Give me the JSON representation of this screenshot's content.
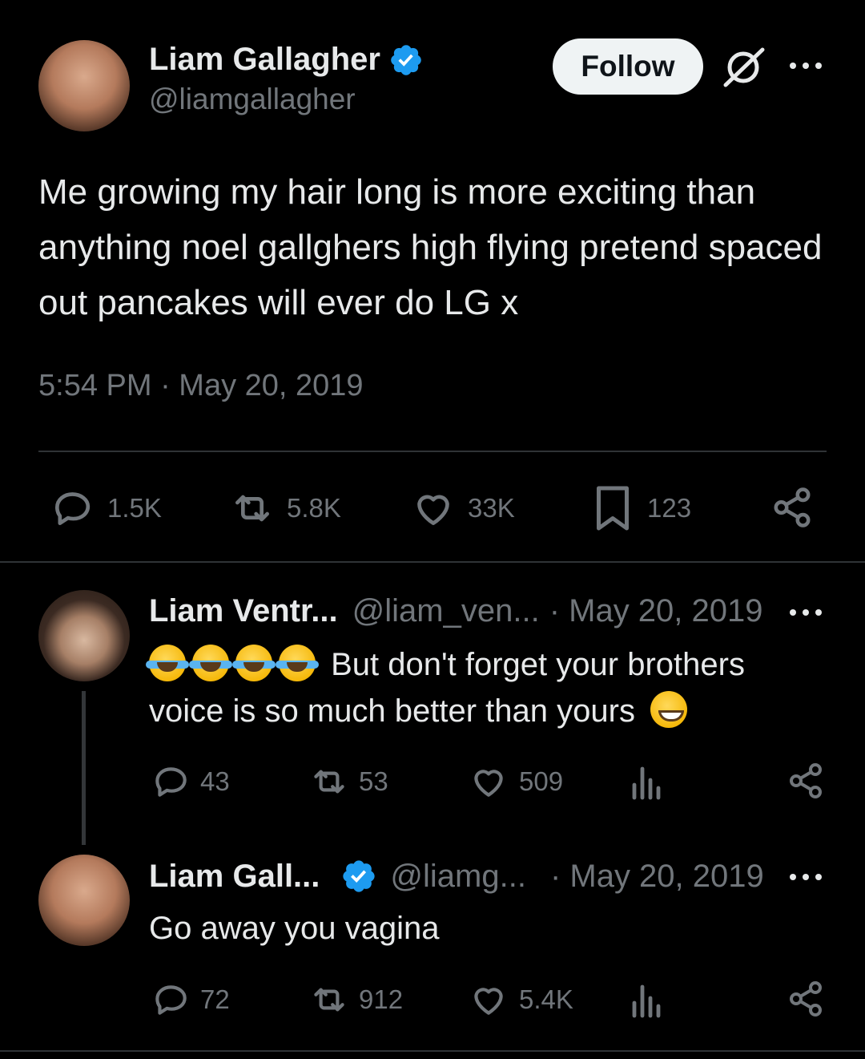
{
  "main_tweet": {
    "display_name": "Liam Gallagher",
    "handle": "@liamgallagher",
    "follow_label": "Follow",
    "text": "Me growing my hair long is more exciting than anything noel gallghers high flying pretend spaced out pancakes will ever do LG x",
    "timestamp": "5:54 PM · May 20, 2019",
    "stats": {
      "replies": "1.5K",
      "reposts": "5.8K",
      "likes": "33K",
      "bookmarks": "123"
    }
  },
  "replies": [
    {
      "display_name": "Liam Ventr...",
      "handle": "@liam_ven...",
      "date": "· May 20, 2019",
      "text_before": "",
      "text": "But don't forget your brothers voice is so much better than yours",
      "emoji_prefix": [
        "face-with-tears-of-joy",
        "face-with-tears-of-joy",
        "face-with-tears-of-joy",
        "face-with-tears-of-joy"
      ],
      "emoji_suffix": "grinning-face-with-smiling-eyes",
      "stats": {
        "replies": "43",
        "reposts": "53",
        "likes": "509"
      }
    },
    {
      "display_name": "Liam Gall...",
      "handle": "@liamg...",
      "date": "· May 20, 2019",
      "text": "Go away you vagina",
      "stats": {
        "replies": "72",
        "reposts": "912",
        "likes": "5.4K"
      }
    }
  ],
  "colors": {
    "background": "#000000",
    "text": "#e7e9ea",
    "muted": "#71767b",
    "verified": "#1d9bf0",
    "divider": "#2f3336",
    "follow_bg": "#eff3f4"
  }
}
